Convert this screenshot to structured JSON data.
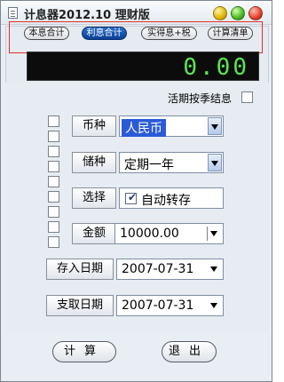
{
  "window": {
    "title": "计息器2012.10 理财版"
  },
  "tabs": [
    {
      "label": "本息合计",
      "active": false
    },
    {
      "label": "利息合计",
      "active": true
    },
    {
      "label": "实得息+税",
      "active": false
    },
    {
      "label": "计算清单",
      "active": false
    }
  ],
  "display": {
    "value": "0.00"
  },
  "options": {
    "live_quarterly_label": "活期按季结息"
  },
  "form": {
    "currency": {
      "label": "币种",
      "value": "人民币"
    },
    "deposit_type": {
      "label": "储种",
      "value": "定期一年"
    },
    "choice": {
      "label": "选择",
      "checkbox_label": "自动转存",
      "checked": true
    },
    "amount": {
      "label": "金额",
      "value": "10000.00"
    },
    "deposit_date": {
      "label": "存入日期",
      "value": "2007-07-31"
    },
    "withdraw_date": {
      "label": "支取日期",
      "value": "2007-07-31"
    }
  },
  "buttons": {
    "calculate": "计算",
    "exit": "退出"
  },
  "colors": {
    "display_digits": "#57e94f",
    "active_tab": "#0b3f95",
    "highlight_frame": "#e0302a"
  }
}
